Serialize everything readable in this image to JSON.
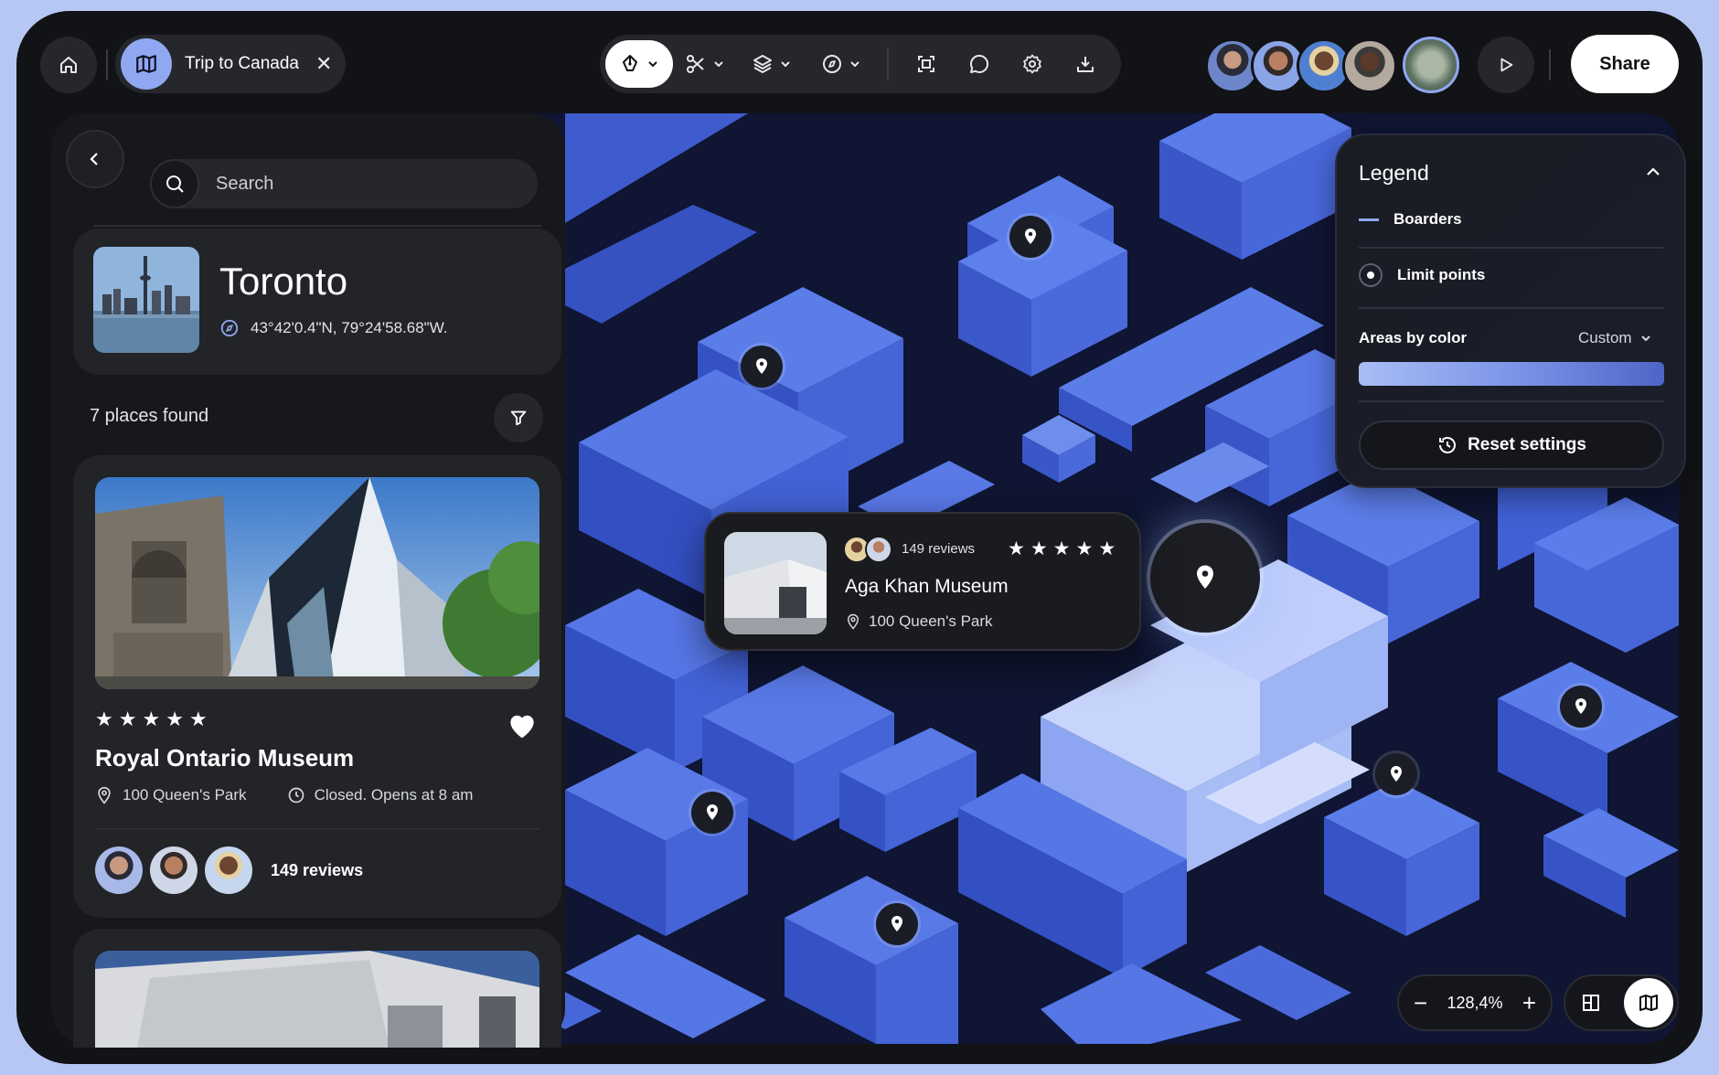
{
  "topbar": {
    "tab_title": "Trip to Canada",
    "share_label": "Share",
    "icons": [
      "home-icon",
      "map-icon",
      "close-icon",
      "pen-tool-icon",
      "scissors-icon",
      "layers-icon",
      "compass-icon",
      "frame-icon",
      "comment-icon",
      "settings-icon",
      "download-icon",
      "play-icon"
    ]
  },
  "sidebar": {
    "search_placeholder": "Search",
    "city": {
      "name": "Toronto",
      "coordinates": "43°42'0.4\"N, 79°24'58.68\"W."
    },
    "places_found": "7 places found",
    "place": {
      "rating": 5,
      "name": "Royal Ontario Museum",
      "address": "100 Queen's Park",
      "hours": "Closed. Opens at 8 am",
      "reviews": "149 reviews"
    }
  },
  "map_popup": {
    "reviews": "149 reviews",
    "rating": 5,
    "name": "Aga Khan Museum",
    "address": "100 Queen's Park"
  },
  "legend": {
    "title": "Legend",
    "item_borders": "Boarders",
    "item_limit_points": "Limit points",
    "areas_label": "Areas by color",
    "areas_select": "Custom",
    "reset_label": "Reset settings"
  },
  "map_controls": {
    "zoom_level": "128,4%"
  },
  "colors": {
    "accent": "#8fa8f1",
    "map_dark": "#0f1532",
    "block": "#4b6fe0",
    "block_light": "#a9bdf5"
  }
}
